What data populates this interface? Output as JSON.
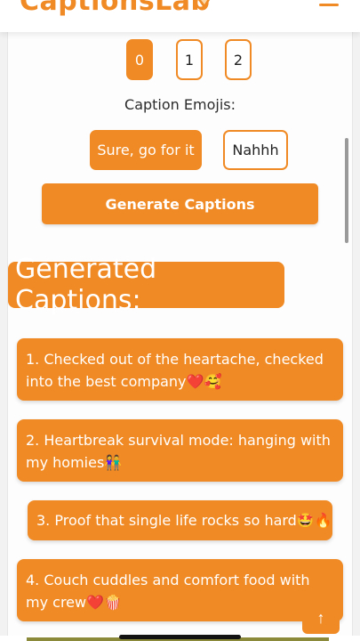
{
  "app": {
    "brand": "CaptionsLab",
    "brand_icon": "pencil-slice-icon",
    "menu_icon": "hamburger-menu-icon"
  },
  "colors": {
    "accent": "#f08a24",
    "text": "#2b2b2b",
    "background": "#fdfdfd"
  },
  "hashtag_options": {
    "items": [
      "0",
      "1",
      "2"
    ],
    "selected": "0"
  },
  "emoji_section": {
    "label": "Caption Emojis:",
    "yes_label": "Sure, go for it",
    "no_label": "Nahhh",
    "selected": "Sure, go for it"
  },
  "generate_button": {
    "label": "Generate Captions"
  },
  "results": {
    "title": "Generated Captions:",
    "captions": [
      "1. Checked out of the heartache, checked into the best company❤️🥰",
      "2. Heartbreak survival mode: hanging with my homies👫",
      "3. Proof that single life rocks so hard🤩🔥",
      "4. Couch cuddles and comfort food with my crew❤️🍿"
    ]
  },
  "back_to_top": {
    "icon": "arrow-up-icon",
    "glyph": "↑"
  }
}
